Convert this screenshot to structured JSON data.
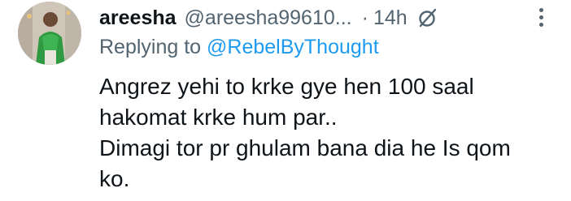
{
  "tweet": {
    "author": {
      "name": "areesha",
      "handle": "@areesha99610...",
      "avatar_icon": "profile-photo"
    },
    "separator": "·",
    "time": "14h",
    "edited_icon": "edit-history-icon",
    "more_icon": "more-options-icon",
    "reply": {
      "prefix": "Replying to",
      "to": "@RebelByThought"
    },
    "lines": [
      "Angrez yehi to krke gye hen 100 saal",
      "hakomat krke hum par..",
      "Dimagi tor pr ghulam bana dia he Is qom",
      "ko."
    ]
  },
  "colors": {
    "text": "#0f1419",
    "secondary": "#536471",
    "link": "#1d9bf0"
  }
}
